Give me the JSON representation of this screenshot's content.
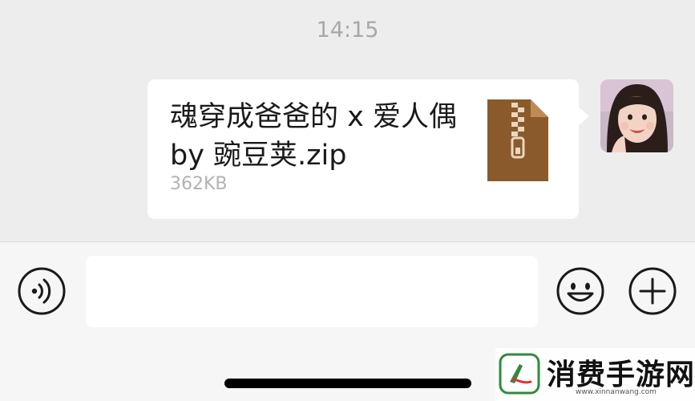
{
  "chat": {
    "timestamp": "14:15",
    "message": {
      "file_name": "魂穿成爸爸的 x 爱人偶 by 豌豆荚.zip",
      "file_size": "362KB",
      "file_icon": "zip-file-icon",
      "file_icon_color": "#8b5a2b"
    },
    "avatar": "user-avatar-photo"
  },
  "input_bar": {
    "text_value": "",
    "voice_icon": "voice-icon",
    "emoji_icon": "emoji-icon",
    "plus_icon": "plus-icon"
  },
  "watermark": {
    "text": "消费手游网",
    "url": "www.xinnanwang.com"
  },
  "colors": {
    "background": "#ededed",
    "bubble": "#ffffff",
    "input_bar": "#f6f6f6",
    "zip_brown": "#8b5a2b",
    "watermark_green": "#2e8b3d"
  }
}
